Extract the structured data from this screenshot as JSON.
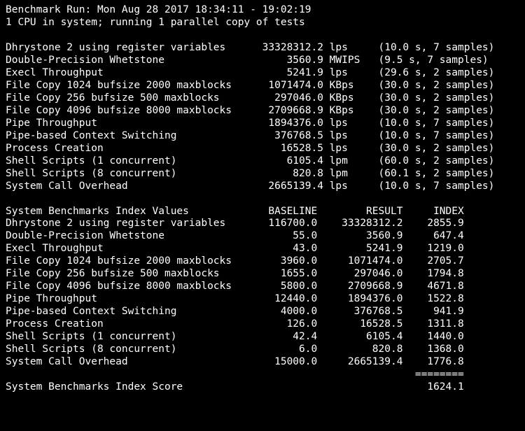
{
  "header": {
    "line1": "Benchmark Run: Mon Aug 28 2017 18:34:11 - 19:02:19",
    "line2": "1 CPU in system; running 1 parallel copy of tests"
  },
  "tests": [
    {
      "name": "Dhrystone 2 using register variables",
      "value": "33328312.2",
      "unit": "lps",
      "note": "(10.0 s, 7 samples)"
    },
    {
      "name": "Double-Precision Whetstone",
      "value": "3560.9",
      "unit": "MWIPS",
      "note": "(9.5 s, 7 samples)"
    },
    {
      "name": "Execl Throughput",
      "value": "5241.9",
      "unit": "lps",
      "note": "(29.6 s, 2 samples)"
    },
    {
      "name": "File Copy 1024 bufsize 2000 maxblocks",
      "value": "1071474.0",
      "unit": "KBps",
      "note": "(30.0 s, 2 samples)"
    },
    {
      "name": "File Copy 256 bufsize 500 maxblocks",
      "value": "297046.0",
      "unit": "KBps",
      "note": "(30.0 s, 2 samples)"
    },
    {
      "name": "File Copy 4096 bufsize 8000 maxblocks",
      "value": "2709668.9",
      "unit": "KBps",
      "note": "(30.0 s, 2 samples)"
    },
    {
      "name": "Pipe Throughput",
      "value": "1894376.0",
      "unit": "lps",
      "note": "(10.0 s, 7 samples)"
    },
    {
      "name": "Pipe-based Context Switching",
      "value": "376768.5",
      "unit": "lps",
      "note": "(10.0 s, 7 samples)"
    },
    {
      "name": "Process Creation",
      "value": "16528.5",
      "unit": "lps",
      "note": "(30.0 s, 2 samples)"
    },
    {
      "name": "Shell Scripts (1 concurrent)",
      "value": "6105.4",
      "unit": "lpm",
      "note": "(60.0 s, 2 samples)"
    },
    {
      "name": "Shell Scripts (8 concurrent)",
      "value": "820.8",
      "unit": "lpm",
      "note": "(60.1 s, 2 samples)"
    },
    {
      "name": "System Call Overhead",
      "value": "2665139.4",
      "unit": "lps",
      "note": "(10.0 s, 7 samples)"
    }
  ],
  "index_header": {
    "title": "System Benchmarks Index Values",
    "col1": "BASELINE",
    "col2": "RESULT",
    "col3": "INDEX"
  },
  "index": [
    {
      "name": "Dhrystone 2 using register variables",
      "baseline": "116700.0",
      "result": "33328312.2",
      "index": "2855.9"
    },
    {
      "name": "Double-Precision Whetstone",
      "baseline": "55.0",
      "result": "3560.9",
      "index": "647.4"
    },
    {
      "name": "Execl Throughput",
      "baseline": "43.0",
      "result": "5241.9",
      "index": "1219.0"
    },
    {
      "name": "File Copy 1024 bufsize 2000 maxblocks",
      "baseline": "3960.0",
      "result": "1071474.0",
      "index": "2705.7"
    },
    {
      "name": "File Copy 256 bufsize 500 maxblocks",
      "baseline": "1655.0",
      "result": "297046.0",
      "index": "1794.8"
    },
    {
      "name": "File Copy 4096 bufsize 8000 maxblocks",
      "baseline": "5800.0",
      "result": "2709668.9",
      "index": "4671.8"
    },
    {
      "name": "Pipe Throughput",
      "baseline": "12440.0",
      "result": "1894376.0",
      "index": "1522.8"
    },
    {
      "name": "Pipe-based Context Switching",
      "baseline": "4000.0",
      "result": "376768.5",
      "index": "941.9"
    },
    {
      "name": "Process Creation",
      "baseline": "126.0",
      "result": "16528.5",
      "index": "1311.8"
    },
    {
      "name": "Shell Scripts (1 concurrent)",
      "baseline": "42.4",
      "result": "6105.4",
      "index": "1440.0"
    },
    {
      "name": "Shell Scripts (8 concurrent)",
      "baseline": "6.0",
      "result": "820.8",
      "index": "1368.0"
    },
    {
      "name": "System Call Overhead",
      "baseline": "15000.0",
      "result": "2665139.4",
      "index": "1776.8"
    }
  ],
  "separator": "========",
  "score": {
    "label": "System Benchmarks Index Score",
    "value": "1624.1"
  }
}
